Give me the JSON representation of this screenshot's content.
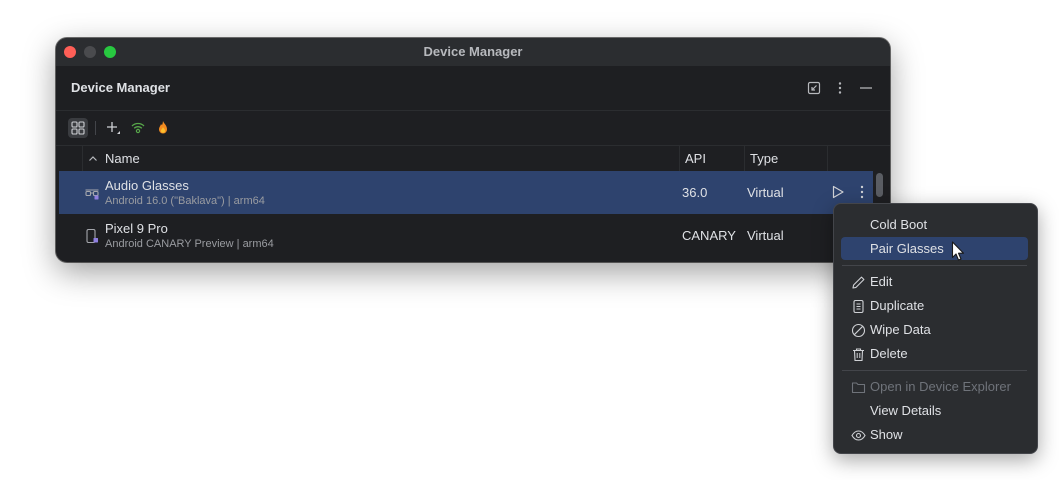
{
  "window": {
    "title": "Device Manager",
    "traffic_lights": [
      "close",
      "minimize",
      "maximize"
    ]
  },
  "panel": {
    "title": "Device Manager",
    "header_icons": [
      "collapse-icon",
      "more-vertical-icon",
      "minimize-icon"
    ]
  },
  "toolbar": {
    "icons": [
      "group-view-icon",
      "add-device-icon",
      "wifi-pairing-icon",
      "firebase-icon"
    ]
  },
  "table": {
    "columns": {
      "name": "Name",
      "api": "API",
      "type": "Type"
    },
    "sort": "ascending",
    "rows": [
      {
        "name": "Audio Glasses",
        "details": "Android 16.0 (\"Baklava\") | arm64",
        "api": "36.0",
        "type": "Virtual",
        "icon": "glasses-device-icon",
        "selected": true
      },
      {
        "name": "Pixel 9 Pro",
        "details": "Android CANARY Preview | arm64",
        "api": "CANARY",
        "type": "Virtual",
        "icon": "phone-device-icon",
        "selected": false
      }
    ]
  },
  "context_menu": {
    "items": [
      {
        "label": "Cold Boot",
        "icon": "",
        "enabled": true,
        "highlighted": false
      },
      {
        "label": "Pair Glasses",
        "icon": "",
        "enabled": true,
        "highlighted": true
      },
      {
        "label": "Edit",
        "icon": "pencil-icon",
        "enabled": true,
        "highlighted": false
      },
      {
        "label": "Duplicate",
        "icon": "duplicate-icon",
        "enabled": true,
        "highlighted": false
      },
      {
        "label": "Wipe Data",
        "icon": "wipe-icon",
        "enabled": true,
        "highlighted": false
      },
      {
        "label": "Delete",
        "icon": "trash-icon",
        "enabled": true,
        "highlighted": false
      },
      {
        "label": "Open in Device Explorer",
        "icon": "folder-icon",
        "enabled": false,
        "highlighted": false
      },
      {
        "label": "View Details",
        "icon": "",
        "enabled": true,
        "highlighted": false
      },
      {
        "label": "Show",
        "icon": "eye-icon",
        "enabled": true,
        "highlighted": false
      }
    ]
  },
  "colors": {
    "window_bg": "#1e1f22",
    "titlebar_bg": "#2b2d30",
    "selection": "#2e436e",
    "text": "#dfe1e5",
    "muted_text": "#9a9ca1",
    "disabled_text": "#6f737a",
    "close": "#ff5f57",
    "maximize": "#28c840",
    "accent_green": "#57a64a",
    "accent_orange": "#f38b20"
  }
}
